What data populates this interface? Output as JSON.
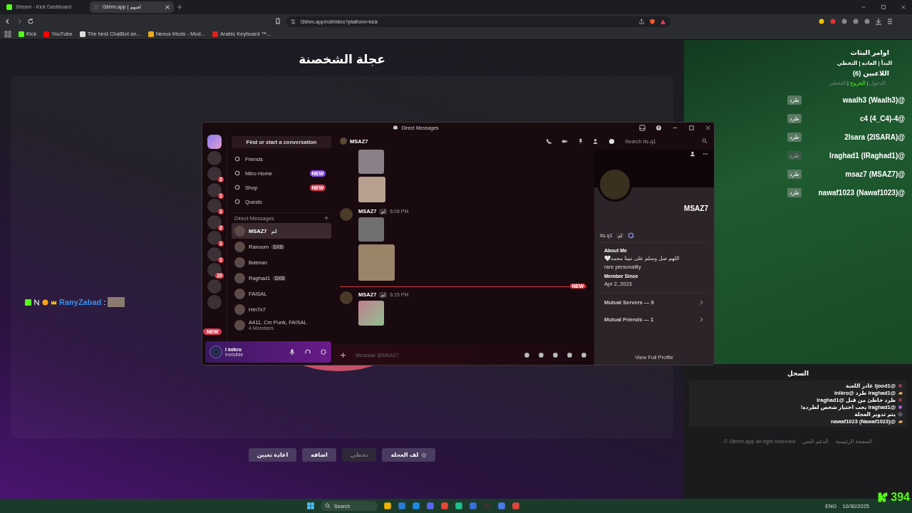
{
  "browser": {
    "tabs": [
      {
        "title": "l3bhm.app | لعبهم",
        "selected": true
      },
      {
        "title": "Stream - Kick Dashboard",
        "selected": false
      }
    ],
    "url": "l3bhm.app/roll/inikro?platform=kick",
    "bookmarks": [
      "Arabic Keyboard ™...",
      "Nexus Mods - Mod...",
      "The best ChatBot an...",
      "YouTube",
      "Kick"
    ]
  },
  "page": {
    "title": "عجلة الشخصنة",
    "chat_line": {
      "user": "RanyZabad",
      "separator": ":"
    },
    "buttons": [
      {
        "label": "لف العجلة",
        "disabled": false,
        "kind": "spin"
      },
      {
        "label": "تخطي",
        "disabled": true,
        "kind": "plain"
      },
      {
        "label": "اضافه",
        "disabled": false,
        "kind": "plain"
      },
      {
        "label": "اعادة تعيين",
        "disabled": false,
        "kind": "plain"
      }
    ]
  },
  "sidebar": {
    "title": "اوامر البثاث",
    "commands": "البدأ | العاده | التخطي",
    "players_title": "اللاعبين (6)",
    "separator": "|",
    "filters": [
      {
        "label": "الدخول",
        "selected": false
      },
      {
        "label": "الخروج",
        "selected": true
      },
      {
        "label": "التخطي",
        "selected": false
      }
    ],
    "players": [
      {
        "name": "waalh3 (Waalh3)@",
        "kick": "طرد",
        "disabled": false
      },
      {
        "name": "c4 (4_C4)-4@",
        "kick": "طرد",
        "disabled": false
      },
      {
        "name": "2lsara (2ISARA)@",
        "kick": "طرد",
        "disabled": false
      },
      {
        "name": "lraghad1 (lRaghad1)@",
        "kick": "طرد",
        "disabled": true
      },
      {
        "name": "msaz7 (MSAZ7)@",
        "kick": "طرد",
        "disabled": false
      },
      {
        "name": "nawaf1023 (Nawaf1023)@",
        "kick": "طرد",
        "disabled": false
      }
    ],
    "log_title": "السجل",
    "log": [
      {
        "kind": "cross",
        "text": "@ljood1 غادر اللعبة"
      },
      {
        "kind": "hand",
        "text": "@lraghad1 طرد @inikro"
      },
      {
        "kind": "cross",
        "text": "طرد خاطئ من قبل @lraghad1"
      },
      {
        "kind": "target",
        "text": "@lraghad1 يجب اختيار شخص لطرده!"
      },
      {
        "kind": "wheel",
        "text": "يتم تدوير العجلة"
      },
      {
        "kind": "hand",
        "text": "@nawaf1023 (Nawaf1023)"
      }
    ],
    "footer": [
      "الصفحة الرئيسية",
      "الدعم الفني",
      "l3bhm.app all right reserved ©"
    ]
  },
  "discord": {
    "title": "Direct Messages",
    "servers": [
      {
        "kind": "home"
      },
      {
        "kind": "avatar"
      },
      {
        "badge": "2",
        "kind": "avatar"
      },
      {
        "badge": "1",
        "kind": "avatar"
      },
      {
        "badge": "1",
        "kind": "avatar"
      },
      {
        "badge": "2",
        "kind": "avatar"
      },
      {
        "badge": "1",
        "kind": "avatar"
      },
      {
        "badge": "1",
        "kind": "avatar"
      },
      {
        "badge": "10",
        "kind": "avatar"
      },
      {
        "kind": "avatar"
      },
      {
        "kind": "avatar"
      }
    ],
    "servers_new": "NEW",
    "search_button": "Find or start a conversation",
    "nav": [
      {
        "label": "Friends"
      },
      {
        "label": "Nitro Home",
        "tag": "NEW",
        "color": "#8c4bf0"
      },
      {
        "label": "Shop",
        "tag": "NEW",
        "color": "#d83a52"
      },
      {
        "label": "Quests"
      }
    ],
    "dm_header": "Direct Messages",
    "dms": [
      {
        "name": "MSAZ7",
        "tag": "لم",
        "selected": true
      },
      {
        "name": "Ranoom",
        "tag": "SXB",
        "selected": false
      },
      {
        "name": "Batman",
        "selected": false
      },
      {
        "name": "Raghad1",
        "tag": "SXB",
        "selected": false
      },
      {
        "name": "FAISAL",
        "selected": false
      },
      {
        "name": "Hm7x7",
        "selected": false
      },
      {
        "name": "A411, Cm Punk, FAISAL",
        "selected": false,
        "sub": "4 Members"
      }
    ],
    "user": {
      "name": "I inikro",
      "status": "Invisible"
    },
    "chat": {
      "name": "MSAZ7",
      "search_placeholder": "Search its.q1",
      "new_label": "NEW",
      "input_placeholder": "Message @MSAZ7",
      "groups": [
        {
          "author": "MSAZ7",
          "tag": "لم",
          "time": "6:08 PM"
        },
        {
          "author": "MSAZ7",
          "tag": "لم",
          "time": "6:15 PM"
        }
      ]
    },
    "profile": {
      "name": "MSAZ7",
      "handle": "its.q1",
      "tag": "لم",
      "about_title": "About Me",
      "about": "اللهم صل وسلم على نبينا محمد🤍",
      "about_2": "rare personality",
      "since_title": "Member Since",
      "since": "Apr 2, 2023",
      "links": [
        "Mutual Servers — 9",
        "Mutual Friends — 1"
      ],
      "view": "View Full Profile"
    }
  },
  "taskbar": {
    "search": "Search",
    "lang": "ENG",
    "date": "10/30/2025",
    "viewers": "394"
  }
}
